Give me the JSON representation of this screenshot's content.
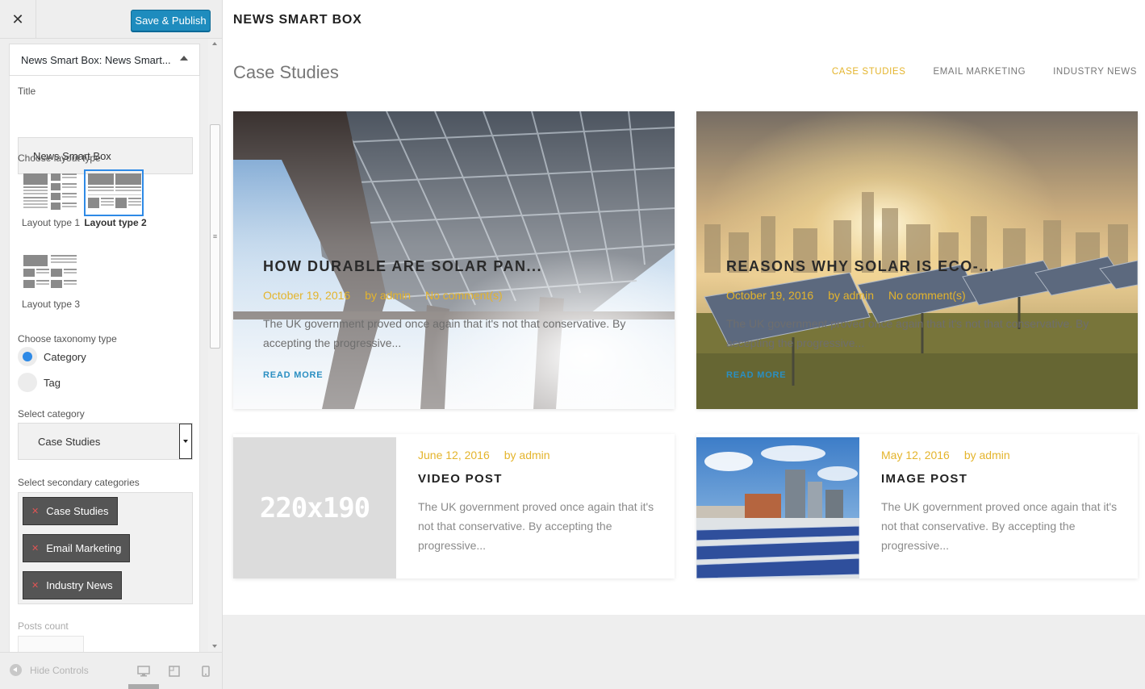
{
  "toolbar": {
    "close_icon": "close-icon",
    "publish_label": "Save & Publish",
    "publish_color": "#1e8cbe"
  },
  "section": {
    "title_prefix": "News Smart Box:",
    "title_name": "News Smart..."
  },
  "form": {
    "title_label": "Title",
    "title_value": "News Smart Box",
    "layout_label": "Choose layout type",
    "layouts": [
      {
        "label": "Layout type 1",
        "selected": false
      },
      {
        "label": "Layout type 2",
        "selected": true
      },
      {
        "label": "Layout type 3",
        "selected": false
      }
    ],
    "taxonomy_label": "Choose taxonomy type",
    "taxonomy_options": [
      {
        "label": "Category",
        "selected": true
      },
      {
        "label": "Tag",
        "selected": false
      }
    ],
    "category_label": "Select category",
    "category_value": "Case Studies",
    "secondary_label": "Select secondary categories",
    "secondary_tags": [
      "Case Studies",
      "Email Marketing",
      "Industry News"
    ],
    "posts_count_label": "Posts count"
  },
  "footer": {
    "hide_controls": "Hide Controls",
    "devices": [
      "desktop-icon",
      "tablet-icon",
      "mobile-icon"
    ]
  },
  "preview": {
    "widget_title": "NEWS SMART BOX",
    "box_title": "Case Studies",
    "tabs": [
      {
        "label": "CASE STUDIES",
        "active": true
      },
      {
        "label": "EMAIL MARKETING",
        "active": false
      },
      {
        "label": "INDUSTRY NEWS",
        "active": false
      }
    ],
    "accent_color": "#e4b42c",
    "featured": [
      {
        "title": "HOW DURABLE ARE SOLAR PAN...",
        "date": "October 19, 2016",
        "author": "by admin",
        "comments": "No comment(s)",
        "excerpt": "The UK government proved once again that it's not that conservative. By accepting the progressive...",
        "read_more": "READ MORE"
      },
      {
        "title": "REASONS WHY SOLAR IS ECO-...",
        "date": "October 19, 2016",
        "author": "by admin",
        "comments": "No comment(s)",
        "excerpt": "The UK government proved once again that it's not that conservative. By accepting the progressive...",
        "read_more": "READ MORE"
      }
    ],
    "posts": [
      {
        "thumb_text": "220x190",
        "date": "June 12, 2016",
        "author": "by admin",
        "title": "VIDEO POST",
        "excerpt": "The UK government proved once again that it's not that conservative. By accepting the progressive..."
      },
      {
        "date": "May 12, 2016",
        "author": "by admin",
        "title": "IMAGE POST",
        "excerpt": "The UK government proved once again that it's not that conservative. By accepting the progressive..."
      }
    ]
  }
}
